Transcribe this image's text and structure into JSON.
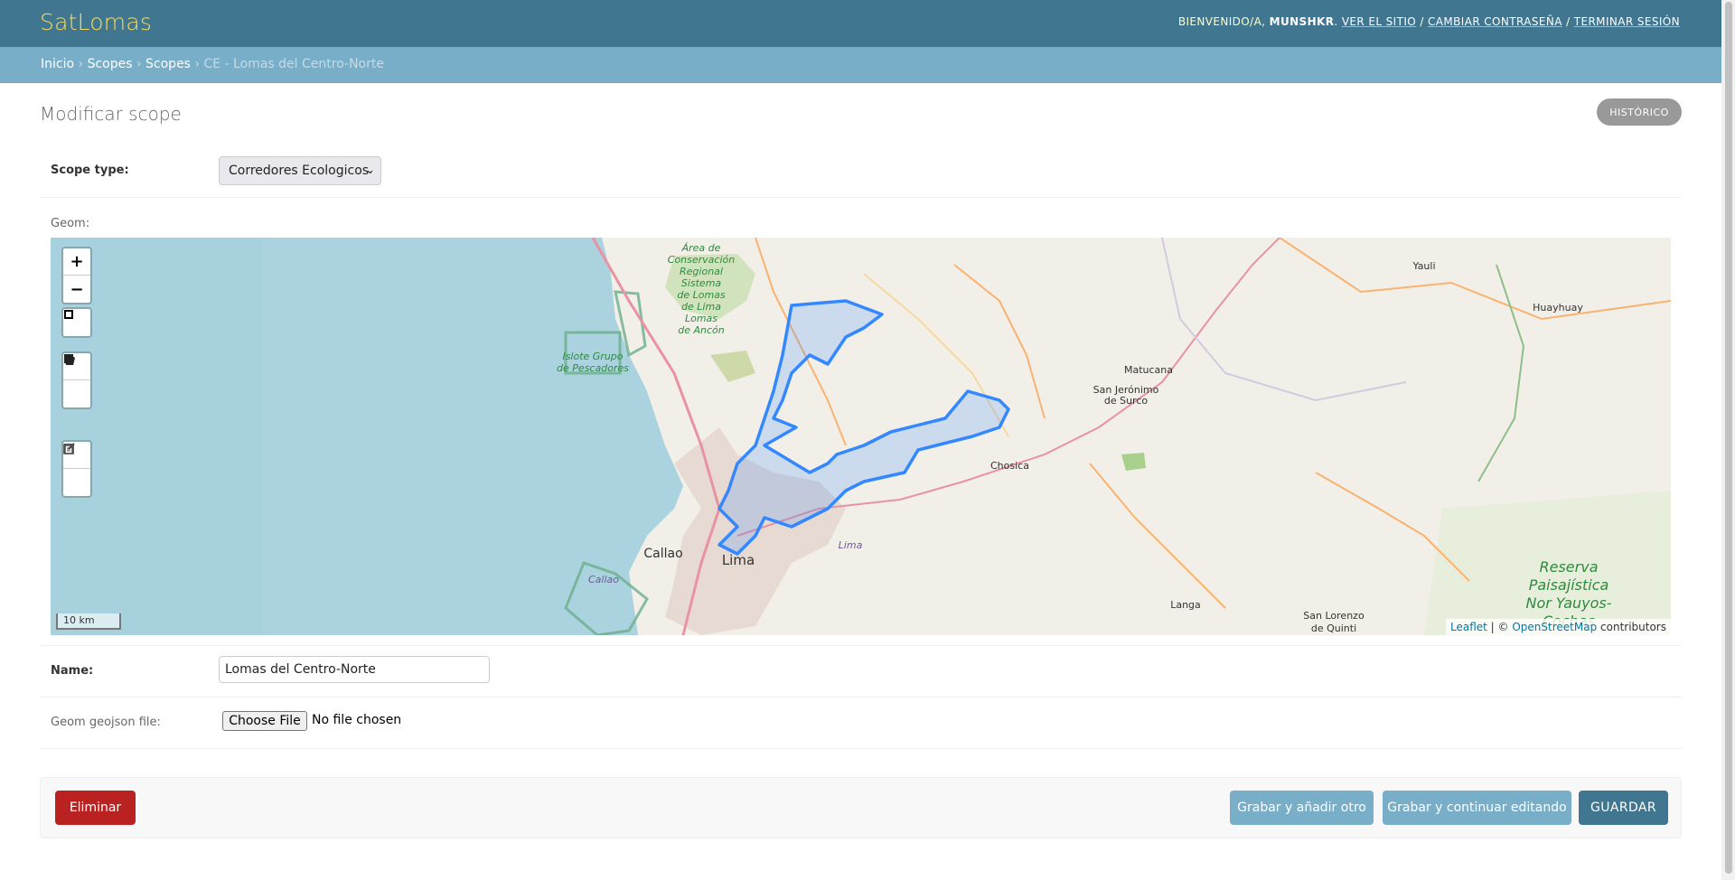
{
  "header": {
    "brand": "SatLomas",
    "welcome": "Bienvenido/a,",
    "username": "munshkr",
    "links": [
      "Ver el sitio",
      "Cambiar contraseña",
      "Terminar sesión"
    ],
    "separator": " / "
  },
  "breadcrumbs": {
    "items": [
      "Inicio",
      "Scopes",
      "Scopes"
    ],
    "current": "CE - Lomas del Centro-Norte",
    "separator": "›"
  },
  "page": {
    "title": "Modificar scope",
    "history_label": "Histórico"
  },
  "form": {
    "scope_type": {
      "label": "Scope type:",
      "value": "Corredores Ecologicos"
    },
    "geom": {
      "label": "Geom:"
    },
    "name": {
      "label": "Name:",
      "value": "Lomas del Centro-Norte"
    },
    "geojson": {
      "label": "Geom geojson file:",
      "button": "Choose File",
      "status": "No file chosen"
    }
  },
  "map": {
    "scale_label": "10 km",
    "attribution": {
      "leaflet": "Leaflet",
      "sep": " | © ",
      "osm": "OpenStreetMap",
      "suffix": " contributors"
    },
    "place_labels": {
      "acp": [
        "Área de",
        "Conservación",
        "Regional",
        "Sistema",
        "de Lomas",
        "de Lima",
        "Lomas",
        "de Ancón"
      ],
      "islote": [
        "Islote Grupo",
        "de Pescadores"
      ],
      "callao": "Callao",
      "callao_water": "Callao",
      "lima": "Lima",
      "lima_district": "Lima",
      "matucana": "Matucana",
      "san_jeronimo": [
        "San Jerónimo",
        "de Surco"
      ],
      "chosica": "Chosica",
      "yauli": "Yauli",
      "huayhuay": "Huayhuay",
      "langa": "Langa",
      "san_lorenzo": [
        "San Lorenzo",
        "de Quinti"
      ],
      "reserva": [
        "Reserva",
        "Paisajística",
        "Nor Yauyos-",
        "Cochas"
      ]
    },
    "colors": {
      "water": "#aad3df",
      "land": "#f2efe9",
      "polygon": "#3388ff",
      "green": "#c8e0b0"
    },
    "controls": {
      "zoom_in": "+",
      "zoom_out": "−",
      "tools": [
        "marker-tool-icon",
        "polygon-tool-icon",
        "rectangle-tool-icon",
        "edit-tool-icon",
        "delete-tool-icon"
      ]
    }
  },
  "actions": {
    "delete": "Eliminar",
    "save_add": "Grabar y añadir otro",
    "save_continue": "Grabar y continuar editando",
    "save": "Guardar"
  }
}
